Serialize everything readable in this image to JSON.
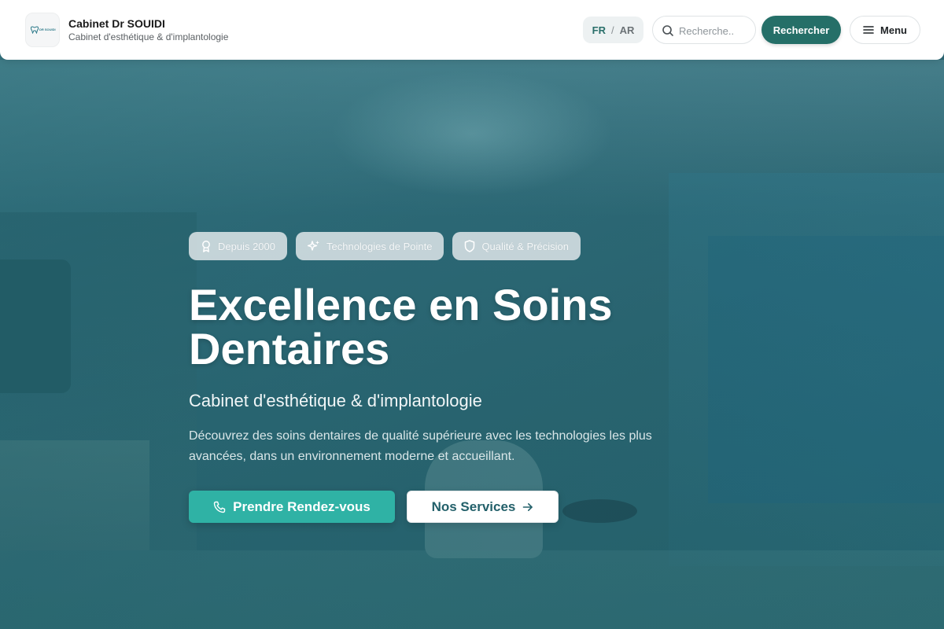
{
  "colors": {
    "accent": "#256f68",
    "cta": "#2fb2a5",
    "hero_overlay": "#2f6a78"
  },
  "header": {
    "logo_text": "DR SOUIDI",
    "title": "Cabinet Dr SOUIDI",
    "subtitle": "Cabinet d'esthétique & d'implantologie",
    "lang": {
      "fr": "FR",
      "separator": "/",
      "ar": "AR"
    },
    "search": {
      "placeholder": "Recherche..",
      "button_label": "Rechercher"
    },
    "menu_label": "Menu"
  },
  "hero": {
    "badges": [
      {
        "icon": "award-icon",
        "label": "Depuis 2000"
      },
      {
        "icon": "sparkles-icon",
        "label": "Technologies de Pointe"
      },
      {
        "icon": "shield-icon",
        "label": "Qualité & Précision"
      }
    ],
    "title_line1": "Excellence en Soins",
    "title_line2": "Dentaires",
    "subtitle": "Cabinet d'esthétique & d'implantologie",
    "description": "Découvrez des soins dentaires de qualité supérieure avec les technologies les plus avancées, dans un environnement moderne et accueillant.",
    "cta_primary": {
      "icon": "phone-icon",
      "label": "Prendre Rendez-vous"
    },
    "cta_secondary": {
      "icon": "arrow-right-icon",
      "label": "Nos Services"
    }
  }
}
